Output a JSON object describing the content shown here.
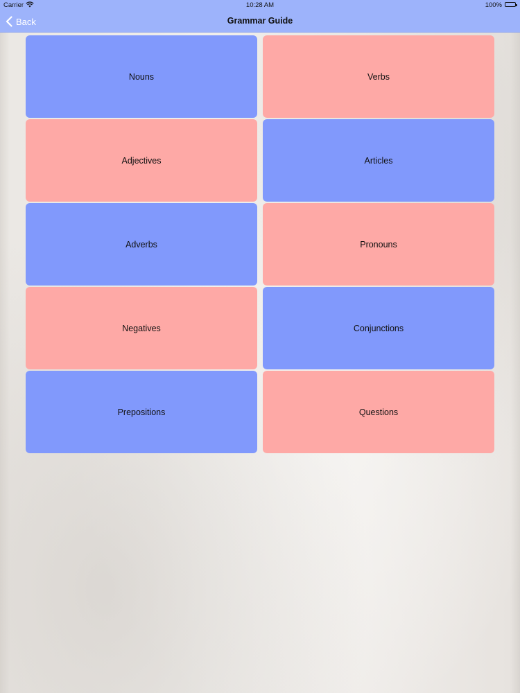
{
  "status_bar": {
    "carrier": "Carrier",
    "time": "10:28 AM",
    "battery": "100%",
    "icons": [
      "wifi-icon",
      "battery-icon"
    ]
  },
  "nav": {
    "back_label": "Back",
    "title": "Grammar Guide",
    "icons": [
      "chevron-left-icon"
    ]
  },
  "colors": {
    "nav_bar": "#9db3fb",
    "tile_blue": "#8199fc",
    "tile_pink": "#fea9a6"
  },
  "tiles": [
    {
      "label": "Nouns",
      "color": "blue"
    },
    {
      "label": "Verbs",
      "color": "pink"
    },
    {
      "label": "Adjectives",
      "color": "pink"
    },
    {
      "label": "Articles",
      "color": "blue"
    },
    {
      "label": "Adverbs",
      "color": "blue"
    },
    {
      "label": "Pronouns",
      "color": "pink"
    },
    {
      "label": "Negatives",
      "color": "pink"
    },
    {
      "label": "Conjunctions",
      "color": "blue"
    },
    {
      "label": "Prepositions",
      "color": "blue"
    },
    {
      "label": "Questions",
      "color": "pink"
    }
  ]
}
